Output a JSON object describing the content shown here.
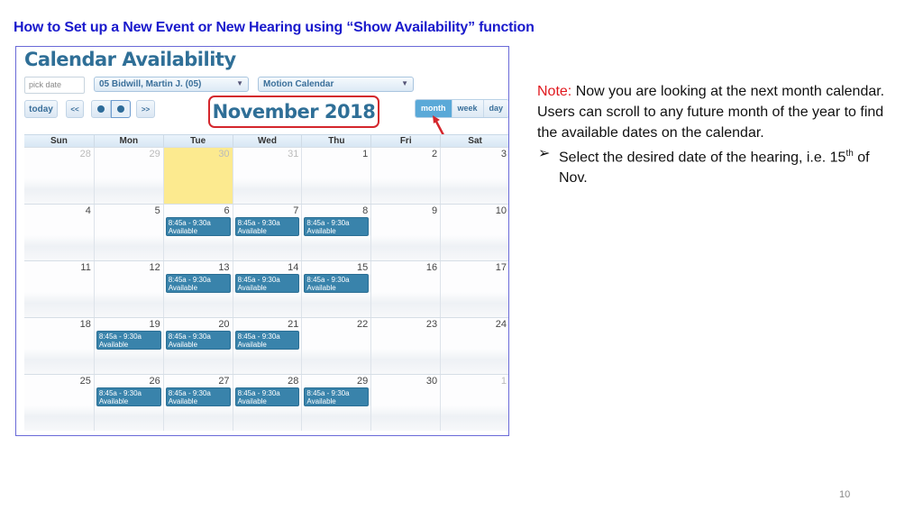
{
  "slide": {
    "title": "How to Set up a New Event or New Hearing using “Show Availability” function",
    "page_number": "10",
    "note_label": "Note:",
    "note_text": " Now you are looking at the next month calendar. Users can scroll to any future month of the year to find the available dates on the calendar.",
    "bullet_mark": "➢",
    "bullet_text": "Select the desired date of the hearing, i.e. 15",
    "bullet_sup": "th",
    "bullet_tail": " of Nov.",
    "accent_color": "#e0181e"
  },
  "app": {
    "title": "Calendar Availability",
    "pick_date_placeholder": "pick date",
    "judge_select": "05 Bidwill, Martin J. (05)",
    "calendar_select": "Motion Calendar",
    "toolbar": {
      "today": "today",
      "prev_year": "<<",
      "next_year": ">>"
    },
    "month_title": "November 2018",
    "views": [
      "month",
      "week",
      "day"
    ],
    "active_view": "month",
    "weekdays": [
      "Sun",
      "Mon",
      "Tue",
      "Wed",
      "Thu",
      "Fri",
      "Sat"
    ],
    "weeks": [
      [
        {
          "d": "28",
          "o": true
        },
        {
          "d": "29",
          "o": true
        },
        {
          "d": "30",
          "o": true,
          "today": true
        },
        {
          "d": "31",
          "o": true
        },
        {
          "d": "1"
        },
        {
          "d": "2"
        },
        {
          "d": "3"
        }
      ],
      [
        {
          "d": "4"
        },
        {
          "d": "5"
        },
        {
          "d": "6",
          "ev": true
        },
        {
          "d": "7",
          "ev": true
        },
        {
          "d": "8",
          "ev": true
        },
        {
          "d": "9"
        },
        {
          "d": "10"
        }
      ],
      [
        {
          "d": "11"
        },
        {
          "d": "12"
        },
        {
          "d": "13",
          "ev": true
        },
        {
          "d": "14",
          "ev": true
        },
        {
          "d": "15",
          "ev": true
        },
        {
          "d": "16"
        },
        {
          "d": "17"
        }
      ],
      [
        {
          "d": "18"
        },
        {
          "d": "19",
          "ev": true
        },
        {
          "d": "20",
          "ev": true
        },
        {
          "d": "21",
          "ev": true
        },
        {
          "d": "22"
        },
        {
          "d": "23"
        },
        {
          "d": "24"
        }
      ],
      [
        {
          "d": "25"
        },
        {
          "d": "26",
          "ev": true
        },
        {
          "d": "27",
          "ev": true
        },
        {
          "d": "28",
          "ev": true
        },
        {
          "d": "29",
          "ev": true
        },
        {
          "d": "30"
        },
        {
          "d": "1",
          "o": true
        }
      ]
    ],
    "event": {
      "time": "8:45a - 9:30a",
      "status": "Available"
    }
  }
}
